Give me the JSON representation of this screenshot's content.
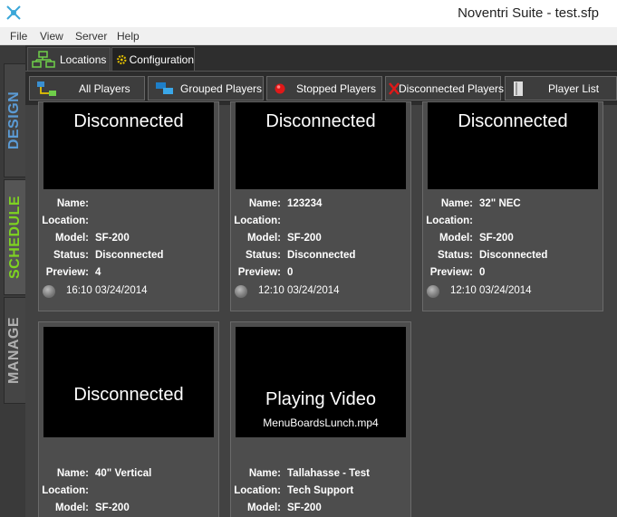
{
  "window": {
    "title": "Noventri Suite - test.sfp"
  },
  "menu": [
    "File",
    "View",
    "Server",
    "Help"
  ],
  "side_tabs": {
    "design": "DESIGN",
    "schedule": "SCHEDULE",
    "manage": "MANAGE"
  },
  "top_tabs": {
    "locations": "Locations",
    "configuration": "Configuration"
  },
  "filters": {
    "all": "All Players",
    "grouped": "Grouped Players",
    "stopped": "Stopped Players",
    "disconnected": "Disconnected Players",
    "list": "Player List"
  },
  "labels": {
    "name": "Name:",
    "location": "Location:",
    "model": "Model:",
    "status": "Status:",
    "preview": "Preview:"
  },
  "players": [
    {
      "screen": "Disconnected",
      "sub": "",
      "name": "",
      "location": "",
      "model": "SF-200",
      "status": "Disconnected",
      "preview": "4",
      "time": "16:10 03/24/2014"
    },
    {
      "screen": "Disconnected",
      "sub": "",
      "name": "123234",
      "location": "",
      "model": "SF-200",
      "status": "Disconnected",
      "preview": "0",
      "time": "12:10 03/24/2014"
    },
    {
      "screen": "Disconnected",
      "sub": "",
      "name": "32\" NEC",
      "location": "",
      "model": "SF-200",
      "status": "Disconnected",
      "preview": "0",
      "time": "12:10 03/24/2014"
    },
    {
      "screen": "Disconnected",
      "sub": "",
      "name": "40\" Vertical",
      "location": "",
      "model": "SF-200"
    },
    {
      "screen": "Playing Video",
      "sub": "MenuBoardsLunch.mp4",
      "name": "Tallahasse - Test",
      "location": "Tech Support",
      "model": "SF-200"
    }
  ]
}
